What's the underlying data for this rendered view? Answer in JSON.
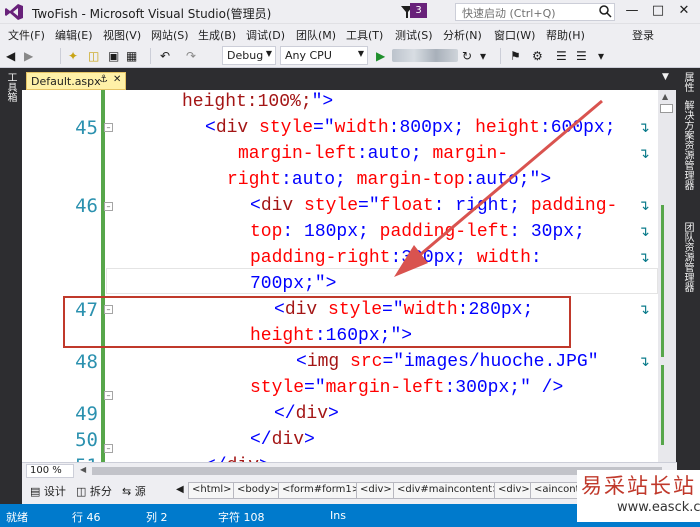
{
  "window": {
    "title": "TwoFish - Microsoft Visual Studio(管理员)",
    "notification_count": "3",
    "quick_launch_placeholder": "快速启动 (Ctrl+Q)",
    "user": "登录"
  },
  "menu": [
    "文件(F)",
    "编辑(E)",
    "视图(V)",
    "网站(S)",
    "生成(B)",
    "调试(D)",
    "团队(M)",
    "工具(T)",
    "测试(S)",
    "分析(N)",
    "窗口(W)",
    "帮助(H)"
  ],
  "toolbar": {
    "configuration": "Debug",
    "platform": "Any CPU"
  },
  "side_panels": {
    "left": "工具箱",
    "right": [
      "属性",
      "解决方案资源管理器",
      "团队资源管理器"
    ]
  },
  "editor": {
    "tab_label": "Default.aspx",
    "lines": [
      {
        "num": "",
        "parts": [
          [
            "tag",
            "height:100%;"
          ],
          [
            "pun",
            "\">"
          ]
        ]
      },
      {
        "num": "45",
        "parts": [
          [
            "pun",
            "<"
          ],
          [
            "tag",
            "div"
          ],
          [
            "attr",
            " style"
          ],
          [
            "pun",
            "=\""
          ],
          [
            "attr",
            "width"
          ],
          [
            "pun",
            ":"
          ],
          [
            "val",
            "800px"
          ],
          [
            "pun",
            "; "
          ],
          [
            "attr",
            "height"
          ],
          [
            "pun",
            ":"
          ],
          [
            "val",
            "600px"
          ],
          [
            "pun",
            ";"
          ]
        ]
      },
      {
        "num": "",
        "parts": [
          [
            "attr",
            "margin-left"
          ],
          [
            "pun",
            ":"
          ],
          [
            "val",
            "auto"
          ],
          [
            "pun",
            "; "
          ],
          [
            "attr",
            "margin-"
          ]
        ]
      },
      {
        "num": "",
        "parts": [
          [
            "attr",
            "right"
          ],
          [
            "pun",
            ":"
          ],
          [
            "val",
            "auto"
          ],
          [
            "pun",
            "; "
          ],
          [
            "attr",
            "margin-top"
          ],
          [
            "pun",
            ":"
          ],
          [
            "val",
            "auto"
          ],
          [
            "pun",
            ";\">"
          ]
        ]
      },
      {
        "num": "46",
        "parts": [
          [
            "pun",
            "<"
          ],
          [
            "tag",
            "div"
          ],
          [
            "attr",
            " style"
          ],
          [
            "pun",
            "=\""
          ],
          [
            "attr",
            "float"
          ],
          [
            "pun",
            ": "
          ],
          [
            "val",
            "right"
          ],
          [
            "pun",
            "; "
          ],
          [
            "attr",
            "padding-"
          ]
        ]
      },
      {
        "num": "",
        "parts": [
          [
            "attr",
            "top"
          ],
          [
            "pun",
            ": "
          ],
          [
            "val",
            "180px"
          ],
          [
            "pun",
            "; "
          ],
          [
            "attr",
            "padding-left"
          ],
          [
            "pun",
            ": "
          ],
          [
            "val",
            "30px"
          ],
          [
            "pun",
            ";"
          ]
        ]
      },
      {
        "num": "",
        "parts": [
          [
            "attr",
            "padding-right"
          ],
          [
            "pun",
            ":"
          ],
          [
            "val",
            "300px"
          ],
          [
            "pun",
            "; "
          ],
          [
            "attr",
            "width"
          ],
          [
            "pun",
            ":"
          ]
        ]
      },
      {
        "num": "",
        "parts": [
          [
            "val",
            "700px"
          ],
          [
            "pun",
            ";\">"
          ]
        ]
      },
      {
        "num": "47",
        "parts": [
          [
            "pun",
            "<"
          ],
          [
            "tag",
            "div"
          ],
          [
            "attr",
            " style"
          ],
          [
            "pun",
            "=\""
          ],
          [
            "attr",
            "width"
          ],
          [
            "pun",
            ":"
          ],
          [
            "val",
            "280px"
          ],
          [
            "pun",
            ";"
          ]
        ]
      },
      {
        "num": "",
        "parts": [
          [
            "attr",
            "height"
          ],
          [
            "pun",
            ":"
          ],
          [
            "val",
            "160px"
          ],
          [
            "pun",
            ";\">"
          ]
        ]
      },
      {
        "num": "48",
        "parts": [
          [
            "pun",
            "<"
          ],
          [
            "tag",
            "img"
          ],
          [
            "attr",
            " src"
          ],
          [
            "pun",
            "=\""
          ],
          [
            "val",
            "images/huoche.JPG"
          ],
          [
            "pun",
            "\""
          ]
        ]
      },
      {
        "num": "",
        "parts": [
          [
            "attr",
            "style"
          ],
          [
            "pun",
            "=\""
          ],
          [
            "attr",
            "margin-left"
          ],
          [
            "pun",
            ":"
          ],
          [
            "val",
            "300px"
          ],
          [
            "pun",
            ";\" />"
          ]
        ]
      },
      {
        "num": "49",
        "parts": [
          [
            "pun",
            "</"
          ],
          [
            "tag",
            "div"
          ],
          [
            "pun",
            ">"
          ]
        ]
      },
      {
        "num": "50",
        "parts": [
          [
            "pun",
            "</"
          ],
          [
            "tag",
            "div"
          ],
          [
            "pun",
            ">"
          ]
        ]
      },
      {
        "num": "51",
        "parts": [
          [
            "pun",
            "</"
          ],
          [
            "tag",
            "div"
          ],
          [
            "pun",
            ">"
          ]
        ]
      }
    ]
  },
  "zoom": "100 %",
  "view_tabs": [
    "设计",
    "拆分",
    "源"
  ],
  "breadcrumb": [
    "<html>",
    "<body>",
    "<form#form1>",
    "<div>",
    "<div#maincontent>",
    "<div>",
    "<ainconten"
  ],
  "status": {
    "ready": "就绪",
    "row": "行 46",
    "col": "列 2",
    "char": "字符 108",
    "mode": "Ins"
  },
  "watermark": {
    "text": "易采站长站",
    "url": "www.easck.com"
  },
  "colors": {
    "status_bar": "#007acc",
    "highlight": "#c0392b",
    "change_bar": "#57a64a",
    "tab_active": "#fff1a8"
  }
}
